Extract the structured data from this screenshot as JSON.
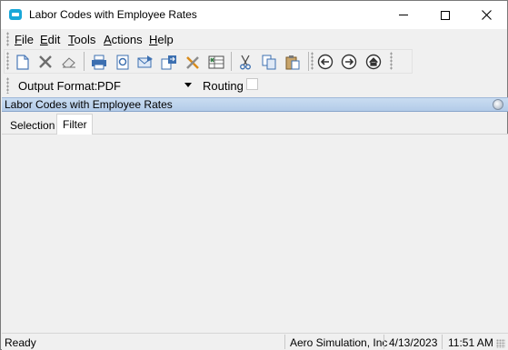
{
  "window": {
    "title": "Labor Codes with Employee Rates"
  },
  "menu": {
    "file": "File",
    "edit": "Edit",
    "tools": "Tools",
    "actions": "Actions",
    "help": "Help"
  },
  "toolbar": {
    "icons": [
      "new-document-icon",
      "delete-icon",
      "eraser-icon",
      "print-icon",
      "print-preview-icon",
      "email-icon",
      "export-icon",
      "tools-icon",
      "excel-icon",
      "cut-icon",
      "copy-icon",
      "paste-icon",
      "back-icon",
      "forward-icon",
      "home-icon"
    ]
  },
  "output": {
    "label": "Output Format:",
    "value": "PDF",
    "routing_label": "Routing",
    "routing_checked": false
  },
  "panel": {
    "title": "Labor Codes with Employee Rates"
  },
  "tabs": {
    "selection": "Selection",
    "filter": "Filter",
    "active": "Filter"
  },
  "status": {
    "state": "Ready",
    "company": "Aero Simulation, Inc",
    "date": "4/13/2023",
    "time": "11:51 AM"
  },
  "colors": {
    "panel_header": "#c9dcf1",
    "app_icon": "#19a7d8"
  }
}
